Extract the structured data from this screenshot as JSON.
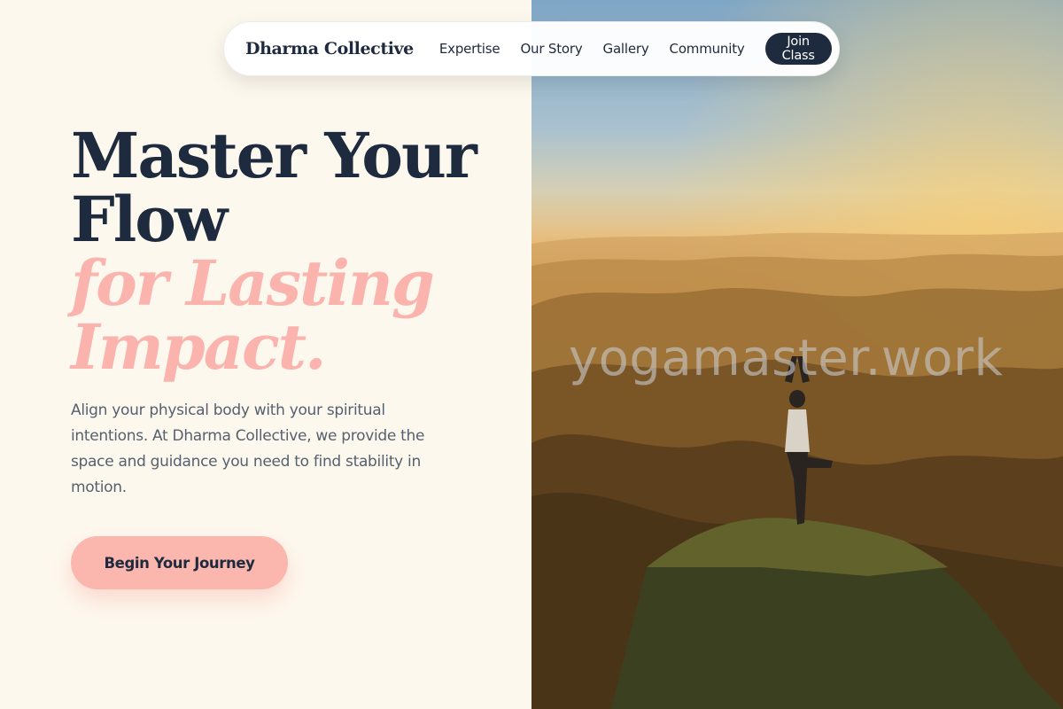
{
  "nav": {
    "brand": "Dharma Collective",
    "links": [
      "Expertise",
      "Our Story",
      "Gallery",
      "Community"
    ],
    "cta_label": "Join Class"
  },
  "hero": {
    "headline_line1": "Master Your",
    "headline_line2": "Flow",
    "accent_line1": "for Lasting",
    "accent_line2": "Impact.",
    "intro": "Align your physical body with your spiritual intentions. At Dharma Collective, we provide the space and guidance you need to find stability in motion.",
    "cta_label": "Begin Your Journey"
  },
  "photo": {
    "watermark": "yogamaster.work",
    "subject": "woman in tree pose on mountain peak at sunset"
  },
  "colors": {
    "navy": "#1e2a3d",
    "accent_pink": "#fbb3ad",
    "cream": "#fdf8ee",
    "body_text": "#56606f"
  }
}
